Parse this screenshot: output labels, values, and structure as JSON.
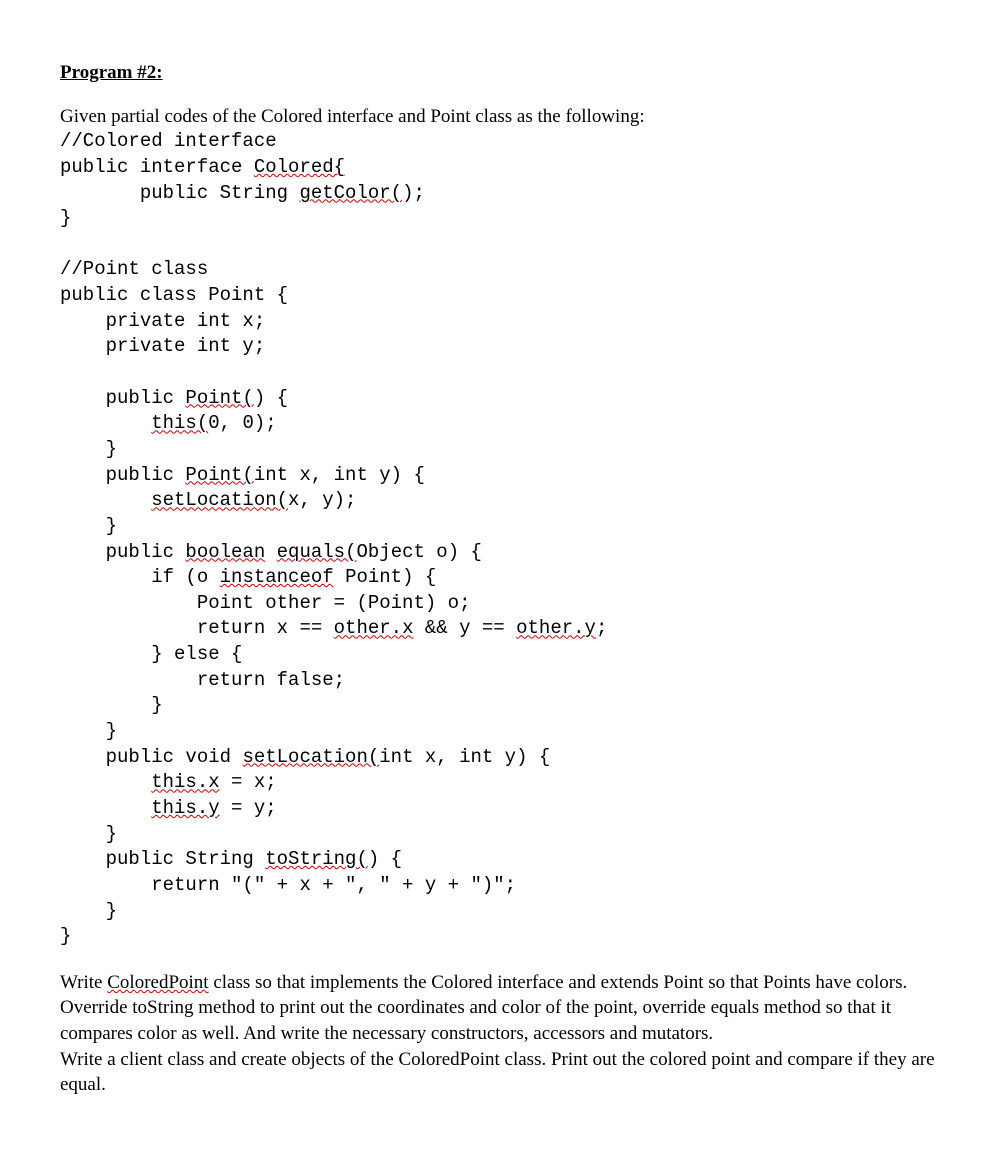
{
  "heading": "Program #2:",
  "intro": "Given partial codes of the Colored interface and Point class as the following:",
  "code": {
    "l01": "//Colored interface",
    "l02a": "public interface ",
    "l02b": "Colored{",
    "l03a": "       public String ",
    "l03b": "getColor(",
    "l03c": ");",
    "l04": "}",
    "l05": "",
    "l06": "//Point class",
    "l07": "public class Point {",
    "l08": "    private int x;",
    "l09": "    private int y;",
    "l10": "",
    "l11a": "    public ",
    "l11b": "Point(",
    "l11c": ") {",
    "l12a": "        ",
    "l12b": "this(",
    "l12c": "0, 0);",
    "l13": "    }",
    "l14a": "    public ",
    "l14b": "Point(",
    "l14c": "int x, int y) {",
    "l15a": "        ",
    "l15b": "setLocation(",
    "l15c": "x, y);",
    "l16": "    }",
    "l17a": "    public ",
    "l17b": "boolean",
    "l17c": " ",
    "l17d": "equals(",
    "l17e": "Object o) {",
    "l18a": "        if (o ",
    "l18b": "instanceof",
    "l18c": " Point) {",
    "l19": "            Point other = (Point) o;",
    "l20a": "            return x == ",
    "l20b": "other.x",
    "l20c": " && y == ",
    "l20d": "other.y",
    "l20e": ";",
    "l21": "        } else {",
    "l22": "            return false;",
    "l23": "        }",
    "l24": "    }",
    "l25a": "    public void ",
    "l25b": "setLocation(",
    "l25c": "int x, int y) {",
    "l26a": "        ",
    "l26b": "this.x",
    "l26c": " = x;",
    "l27a": "        ",
    "l27b": "this.y",
    "l27c": " = y;",
    "l28": "    }",
    "l29a": "    public String ",
    "l29b": "toString(",
    "l29c": ") {",
    "l30": "        return \"(\" + x + \", \" + y + \")\";",
    "l31": "    }",
    "l32": "}"
  },
  "para1a": "Write ",
  "para1b": "ColoredPoint",
  "para1c": " class so that implements the Colored interface and extends Point so that Points have colors. Override toString method to print out the coordinates and color of the point, override equals method so that it compares color as well. And write the necessary constructors, accessors and mutators.",
  "para2": "Write a client class and create objects of the ColoredPoint class. Print out the colored point and compare if they are equal."
}
